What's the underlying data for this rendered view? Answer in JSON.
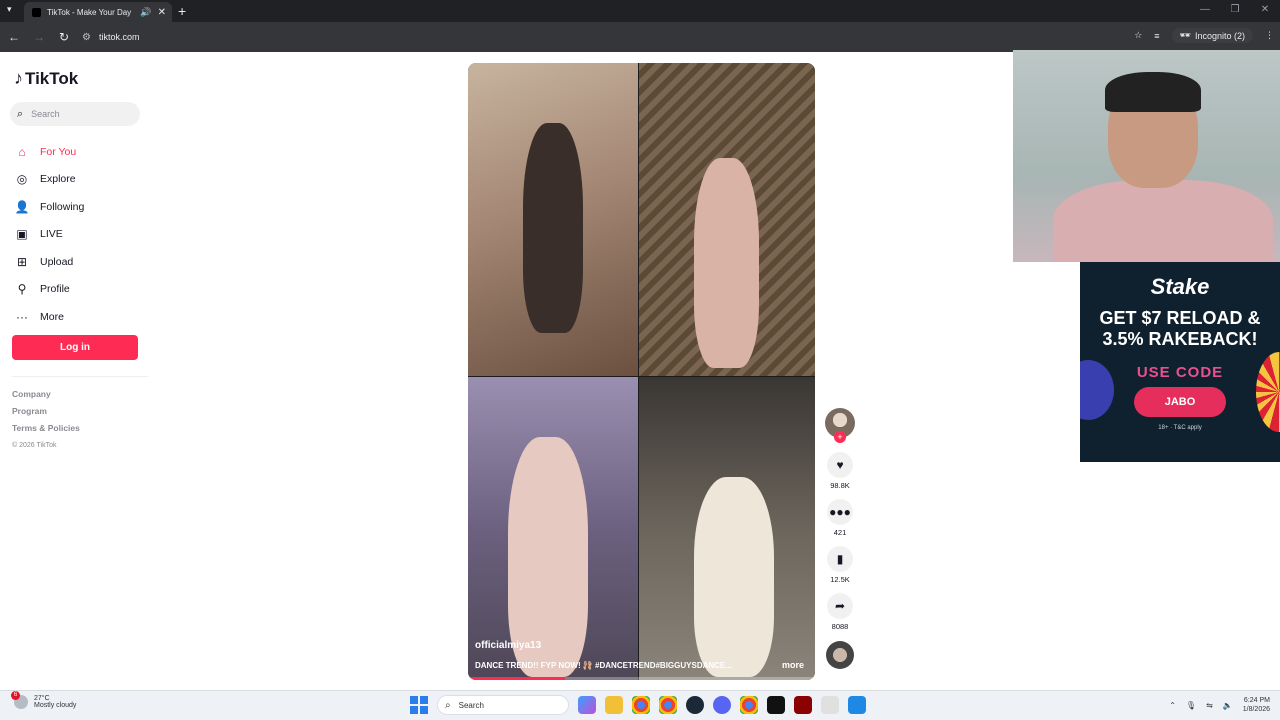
{
  "browser": {
    "tab_title": "TikTok - Make Your Day",
    "url": "tiktok.com",
    "incognito_label": "Incognito (2)"
  },
  "sidebar": {
    "logo": "TikTok",
    "search_placeholder": "Search",
    "nav": [
      {
        "label": "For You",
        "icon": "home-icon",
        "active": true
      },
      {
        "label": "Explore",
        "icon": "compass-icon"
      },
      {
        "label": "Following",
        "icon": "following-icon"
      },
      {
        "label": "LIVE",
        "icon": "live-icon"
      },
      {
        "label": "Upload",
        "icon": "upload-icon"
      },
      {
        "label": "Profile",
        "icon": "profile-icon"
      },
      {
        "label": "More",
        "icon": "more-icon"
      }
    ],
    "login_label": "Log in",
    "footer": {
      "company": "Company",
      "program": "Program",
      "terms": "Terms & Policies",
      "copyright": "© 2026 TikTok"
    }
  },
  "video": {
    "username": "officialmiya13",
    "description": "DANCE TREND!! FYP NOW! 🩰 #DANCETREND#BIGGUYSDANCE...",
    "more_label": "more",
    "progress": 0.28
  },
  "actions": {
    "likes": "98.8K",
    "comments": "421",
    "saves": "12.5K",
    "shares": "8088"
  },
  "overlay_ad": {
    "brand": "Stake",
    "headline_1": "GET $7 RELOAD &",
    "headline_2": "3.5% RAKEBACK!",
    "use_code": "USE CODE",
    "code": "JABO",
    "fine_print": "18+ · T&C apply"
  },
  "taskbar": {
    "temperature": "27°C",
    "weather": "Mostly cloudy",
    "weather_badge": "6",
    "search_placeholder": "Search",
    "time": "6:24 PM",
    "date": "1/8/2026"
  },
  "colors": {
    "accent": "#fe2c55",
    "browser_bg": "#202124",
    "ad_bg": "#0f212e"
  }
}
